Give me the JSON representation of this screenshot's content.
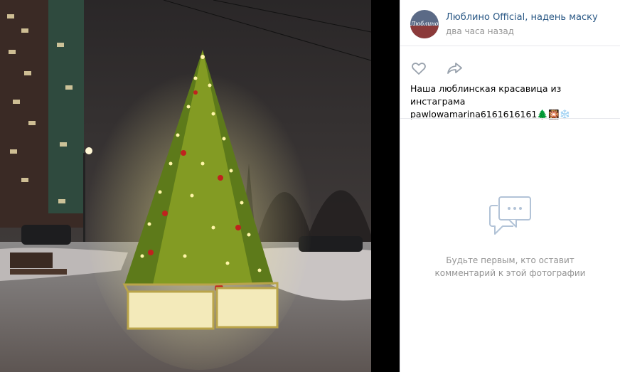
{
  "post": {
    "author": "Люблино Official, надень маску",
    "time": "два часа назад",
    "avatar_text": "Люблино",
    "caption_line1": "Наша люблинская красавица из инстаграма",
    "caption_line2": "pawlowamarina6161616161",
    "caption_emojis": "🌲🎇❄️"
  },
  "actions": {
    "like_icon": "heart-icon",
    "share_icon": "share-arrow-icon"
  },
  "comments": {
    "empty_icon": "chat-bubbles-icon",
    "empty_line1": "Будьте первым, кто оставит",
    "empty_line2": "комментарий к этой фотографии"
  },
  "colors": {
    "link": "#2a5885",
    "muted": "#939393",
    "icon": "#99a2ad",
    "empty_icon": "#b2c3d7"
  }
}
